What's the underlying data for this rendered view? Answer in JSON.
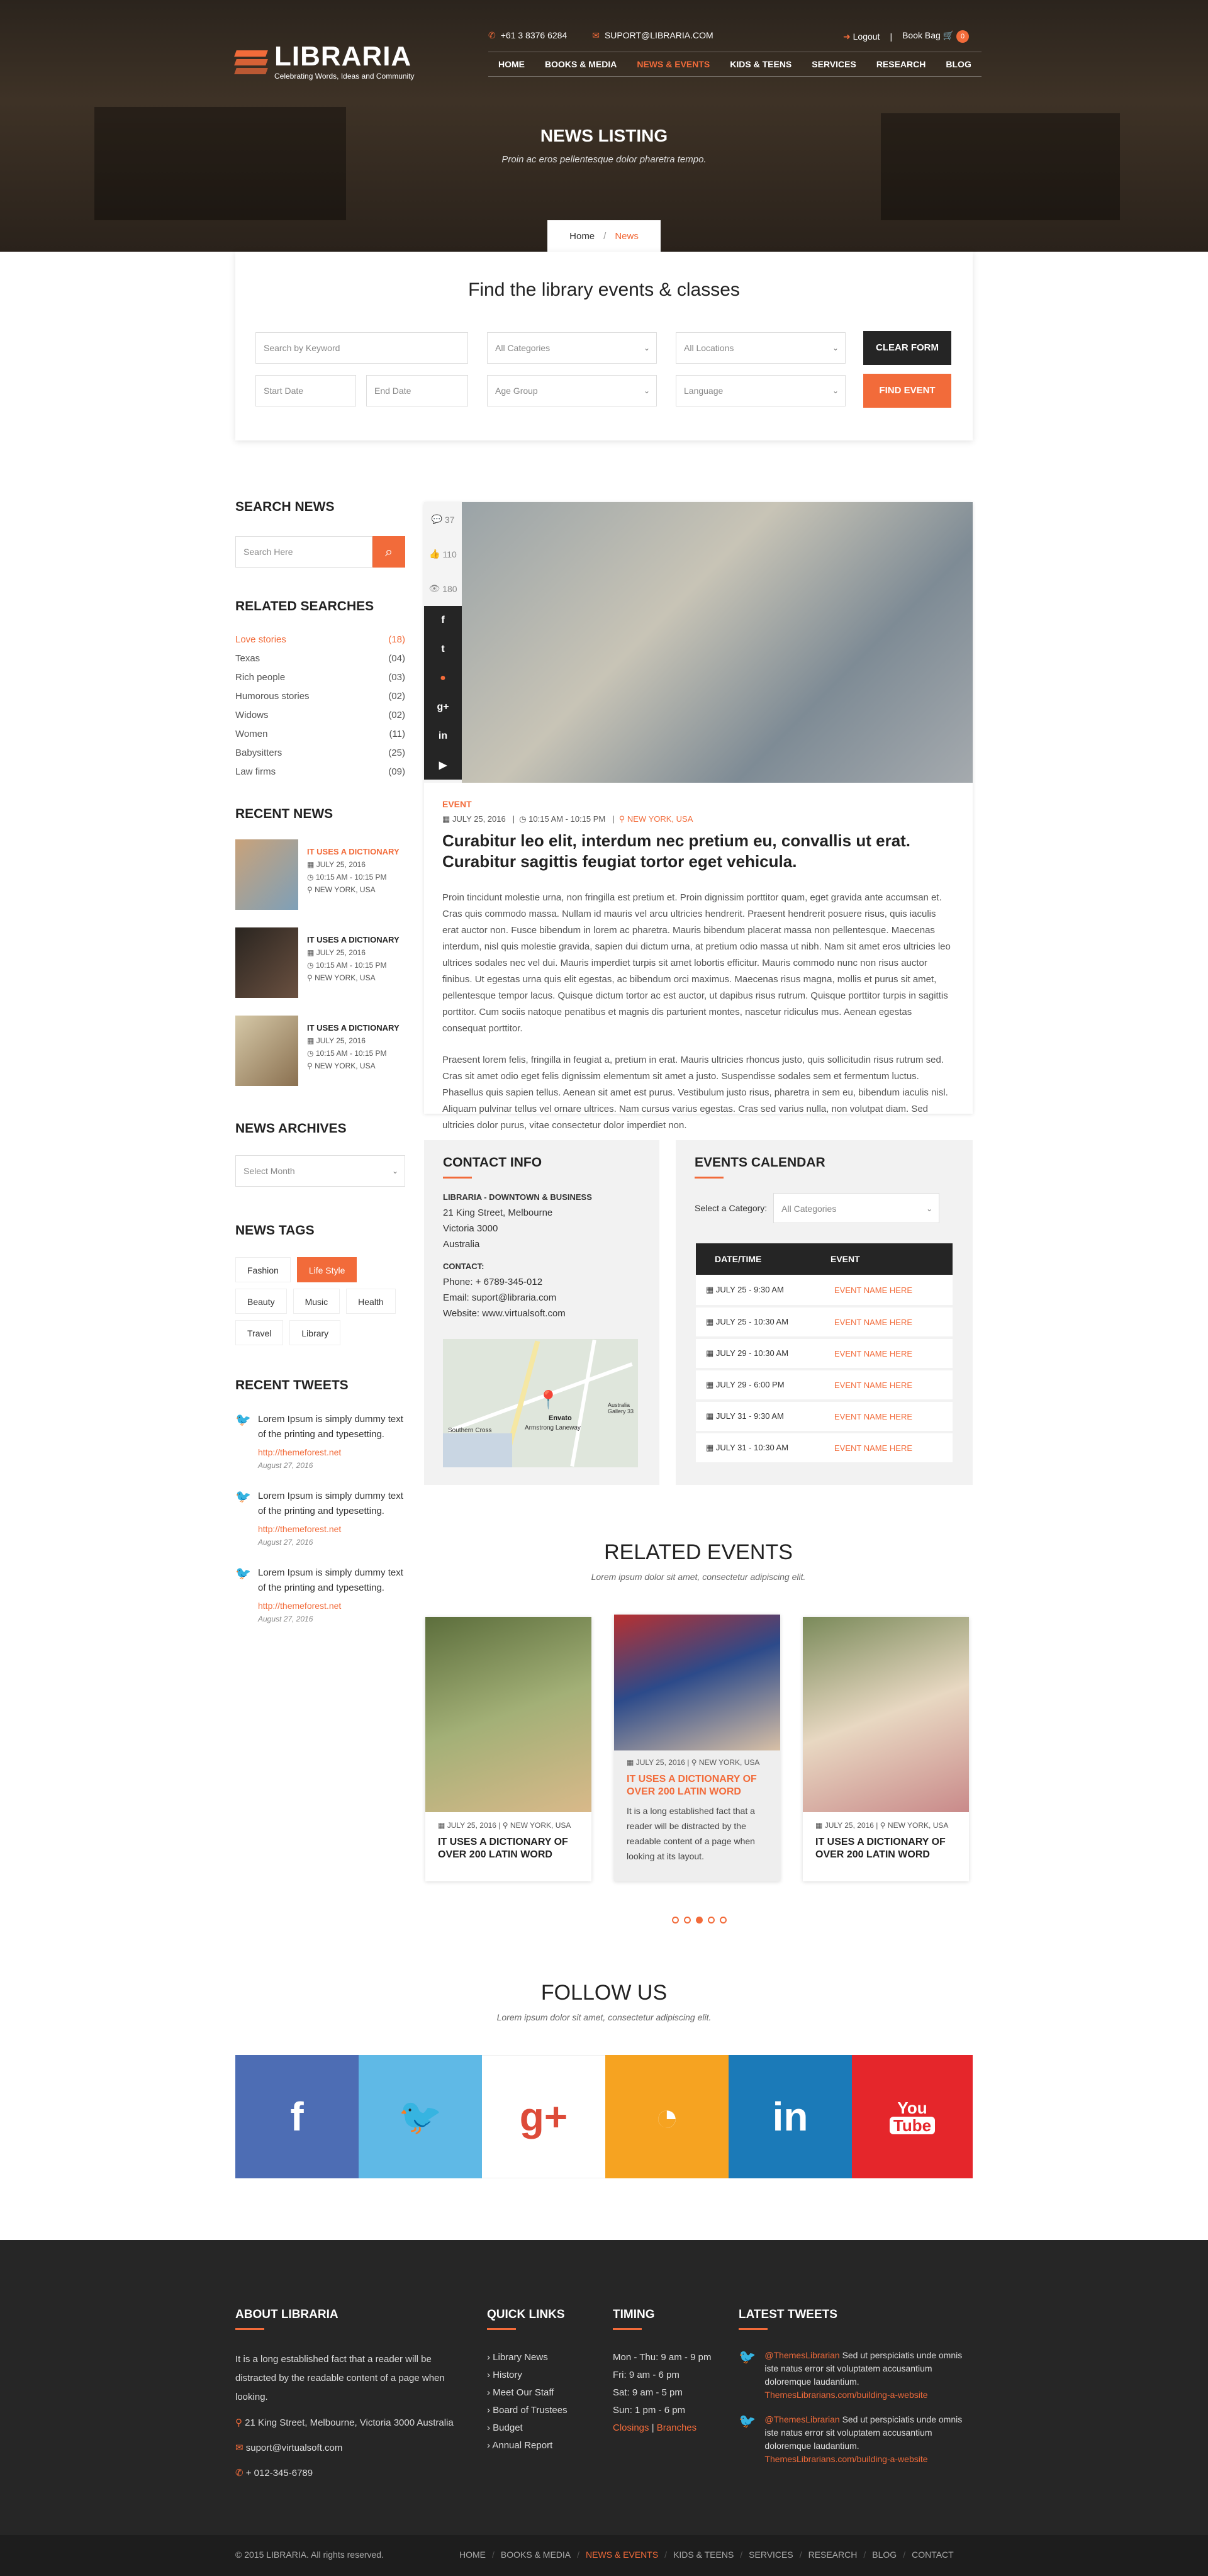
{
  "brand": {
    "name": "LIBRARIA",
    "tagline": "Celebrating Words, Ideas and Community"
  },
  "topbar": {
    "phone": "+61 3 8376 6284",
    "email": "SUPORT@LIBRARIA.COM",
    "logout": "Logout",
    "book_bag": "Book Bag",
    "bag_count": "0"
  },
  "nav": [
    "HOME",
    "BOOKS & MEDIA",
    "NEWS & EVENTS",
    "KIDS & TEENS",
    "SERVICES",
    "RESEARCH",
    "BLOG"
  ],
  "hero": {
    "title": "NEWS LISTING",
    "subtitle": "Proin ac eros pellentesque dolor pharetra tempo."
  },
  "breadcrumb": {
    "home": "Home",
    "current": "News"
  },
  "search_panel": {
    "title": "Find the library events & classes",
    "keyword_placeholder": "Search by Keyword",
    "categories": "All Categories",
    "locations": "All Locations",
    "start_date": "Start Date",
    "end_date": "End Date",
    "age_group": "Age Group",
    "language": "Language",
    "clear_label": "CLEAR FORM",
    "find_label": "FIND EVENT"
  },
  "sidebar": {
    "search_title": "SEARCH NEWS",
    "search_placeholder": "Search Here",
    "related_title": "RELATED SEARCHES",
    "related": [
      {
        "label": "Love stories",
        "count": "(18)"
      },
      {
        "label": "Texas",
        "count": "(04)"
      },
      {
        "label": "Rich people",
        "count": "(03)"
      },
      {
        "label": "Humorous stories",
        "count": "(02)"
      },
      {
        "label": "Widows",
        "count": "(02)"
      },
      {
        "label": "Women",
        "count": "(11)"
      },
      {
        "label": "Babysitters",
        "count": "(25)"
      },
      {
        "label": "Law firms",
        "count": "(09)"
      }
    ],
    "recent_title": "RECENT NEWS",
    "recent": [
      {
        "title": "IT USES A DICTIONARY",
        "date": "JULY 25, 2016",
        "time": "10:15 AM - 10:15 PM",
        "place": "NEW YORK, USA"
      },
      {
        "title": "IT USES A DICTIONARY",
        "date": "JULY 25, 2016",
        "time": "10:15 AM - 10:15 PM",
        "place": "NEW YORK, USA"
      },
      {
        "title": "IT USES A DICTIONARY",
        "date": "JULY 25, 2016",
        "time": "10:15 AM - 10:15 PM",
        "place": "NEW YORK, USA"
      }
    ],
    "archives_title": "NEWS ARCHIVES",
    "archives_select": "Select Month",
    "tags_title": "NEWS TAGS",
    "tags": [
      "Fashion",
      "Life Style",
      "Beauty",
      "Music",
      "Health",
      "Travel",
      "Library"
    ],
    "tweets_title": "RECENT TWEETS",
    "tweets": [
      {
        "text": "Lorem Ipsum is simply dummy text of the printing and typesetting.",
        "link": "http://themeforest.net",
        "date": "August 27, 2016"
      },
      {
        "text": "Lorem Ipsum is simply dummy text of the printing and typesetting.",
        "link": "http://themeforest.net",
        "date": "August 27, 2016"
      },
      {
        "text": "Lorem Ipsum is simply dummy text of the printing and typesetting.",
        "link": "http://themeforest.net",
        "date": "August 27, 2016"
      }
    ]
  },
  "article": {
    "comments": "37",
    "likes": "110",
    "views": "180",
    "category": "EVENT",
    "date": "JULY 25, 2016",
    "time": "10:15 AM - 10:15 PM",
    "place": "NEW YORK, USA",
    "title": "Curabitur leo elit, interdum nec pretium eu, convallis ut erat. Curabitur sagittis feugiat tortor eget vehicula.",
    "p1": "Proin tincidunt molestie urna, non fringilla est pretium et. Proin dignissim porttitor quam, eget gravida ante accumsan et. Cras quis commodo massa. Nullam id mauris vel arcu ultricies hendrerit. Praesent hendrerit posuere risus, quis iaculis erat auctor non. Fusce bibendum in lorem ac pharetra. Mauris bibendum placerat massa non pellentesque. Maecenas interdum, nisl quis molestie gravida, sapien dui dictum urna, at pretium odio massa ut nibh. Nam sit amet eros ultricies leo ultrices sodales nec vel dui. Mauris imperdiet turpis sit amet lobortis efficitur. Mauris commodo nunc non risus auctor finibus. Ut egestas urna quis elit egestas, ac bibendum orci maximus. Maecenas risus magna, mollis et purus sit amet, pellentesque tempor lacus. Quisque dictum tortor ac est auctor, ut dapibus risus rutrum. Quisque porttitor turpis in sagittis porttitor. Cum sociis natoque penatibus et magnis dis parturient montes, nascetur ridiculus mus. Aenean egestas consequat porttitor.",
    "p2": "Praesent lorem felis, fringilla in feugiat a, pretium in erat. Mauris ultricies rhoncus justo, quis sollicitudin risus rutrum sed. Cras sit amet odio eget felis dignissim elementum sit amet a justo. Suspendisse sodales sem et fermentum luctus. Phasellus quis sapien tellus. Aenean sit amet est purus. Vestibulum justo risus, pharetra in sem eu, bibendum iaculis nisl. Aliquam pulvinar tellus vel ornare ultrices. Nam cursus varius egestas. Cras sed varius nulla, non volutpat diam. Sed ultricies dolor purus, vitae consectetur dolor imperdiet non."
  },
  "contact": {
    "title": "CONTACT INFO",
    "org": "LIBRARIA - DOWNTOWN & BUSINESS",
    "addr1": "21 King Street, Melbourne",
    "addr2": "Victoria 3000",
    "addr3": "Australia",
    "contact_label": "CONTACT:",
    "phone": "Phone: + 6789-345-012",
    "email": "Email: suport@libraria.com",
    "website": "Website: www.virtualsoft.com",
    "map_label": "Envato",
    "map_sub": "Armstrong Laneway",
    "map_place": "Southern Cross",
    "map_bldg": "Australia Gallery 33"
  },
  "calendar": {
    "title": "EVENTS CALENDAR",
    "cat_label": "Select a Category:",
    "cat_value": "All Categories",
    "head_date": "DATE/TIME",
    "head_event": "EVENT",
    "rows": [
      {
        "date": "JULY 25 - 9:30 AM",
        "event": "EVENT NAME HERE"
      },
      {
        "date": "JULY 25 - 10:30 AM",
        "event": "EVENT NAME HERE"
      },
      {
        "date": "JULY 29 - 10:30 AM",
        "event": "EVENT NAME HERE"
      },
      {
        "date": "JULY 29 - 6:00 PM",
        "event": "EVENT NAME HERE"
      },
      {
        "date": "JULY 31 - 9:30 AM",
        "event": "EVENT NAME HERE"
      },
      {
        "date": "JULY 31 - 10:30 AM",
        "event": "EVENT NAME HERE"
      }
    ]
  },
  "related": {
    "title": "RELATED EVENTS",
    "subtitle": "Lorem ipsum dolor sit amet, consectetur adipiscing elit.",
    "cards": [
      {
        "date": "JULY 25, 2016",
        "place": "NEW YORK, USA",
        "title": "IT USES A DICTIONARY OF OVER 200 LATIN WORD"
      },
      {
        "date": "JULY 25, 2016",
        "place": "NEW YORK, USA",
        "title": "IT USES A DICTIONARY OF OVER 200 LATIN WORD",
        "text": "It is a long established fact that a reader will be distracted by the readable content of a page when looking at its layout."
      },
      {
        "date": "JULY 25, 2016",
        "place": "NEW YORK, USA",
        "title": "IT USES A DICTIONARY OF OVER 200 LATIN WORD"
      }
    ]
  },
  "follow": {
    "title": "FOLLOW US",
    "subtitle": "Lorem ipsum dolor sit amet, consectetur adipiscing elit.",
    "yt1": "You",
    "yt2": "Tube",
    "colors": [
      "#4d6db4",
      "#5fb9e6",
      "#ffffff",
      "#f6a321",
      "#1b7ab8",
      "#e5262b"
    ]
  },
  "footer": {
    "about_title": "ABOUT LIBRARIA",
    "about_text": "It is a long established fact that a reader will be distracted by the readable content of a page when looking.",
    "address": "21 King Street, Melbourne, Victoria 3000 Australia",
    "email": "suport@virtualsoft.com",
    "phone": "+ 012-345-6789",
    "links_title": "QUICK LINKS",
    "links": [
      "Library News",
      "History",
      "Meet Our Staff",
      "Board of Trustees",
      "Budget",
      "Annual Report"
    ],
    "timing_title": "TIMING",
    "timing": [
      "Mon - Thu: 9 am - 9 pm",
      "Fri: 9 am - 6 pm",
      "Sat: 9 am - 5 pm",
      "Sun: 1 pm - 6 pm"
    ],
    "closings": "Closings",
    "branches": "Branches",
    "tweets_title": "LATEST TWEETS",
    "tweets": [
      {
        "handle": "@ThemesLibrarian",
        "text": "Sed ut perspiciatis unde omnis iste natus error sit voluptatem accusantium doloremque laudantium.",
        "link": "ThemesLibrarians.com/building-a-website"
      },
      {
        "handle": "@ThemesLibrarian",
        "text": "Sed ut perspiciatis unde omnis iste natus error sit voluptatem accusantium doloremque laudantium.",
        "link": "ThemesLibrarians.com/building-a-website"
      }
    ],
    "copyright": "© 2015 LIBRARIA. All rights reserved.",
    "nav": [
      "HOME",
      "BOOKS & MEDIA",
      "NEWS & EVENTS",
      "KIDS & TEENS",
      "SERVICES",
      "RESEARCH",
      "BLOG",
      "CONTACT"
    ]
  }
}
